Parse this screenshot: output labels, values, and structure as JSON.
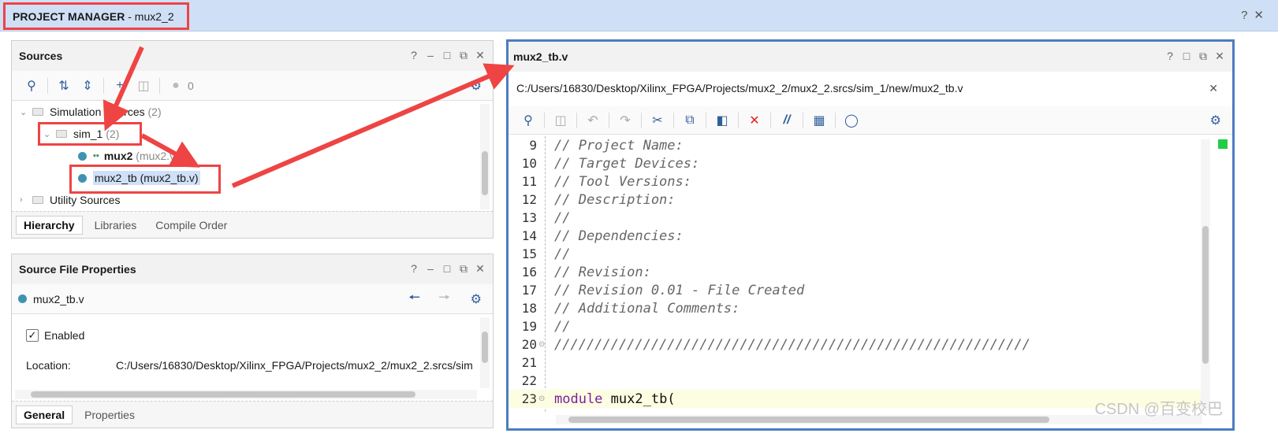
{
  "top_bar": {
    "title_bold": "PROJECT MANAGER",
    "title_rest": " - mux2_2",
    "help": "?",
    "close": "✕"
  },
  "sources": {
    "title": "Sources",
    "status_count": "0",
    "tree": [
      {
        "label": "Simulation Sources",
        "count": "(2)"
      },
      {
        "label": "sim_1",
        "count": "(2)"
      },
      {
        "label": "mux2",
        "suffix": "(mux2.v)"
      },
      {
        "label": "mux2_tb (mux2_tb.v)"
      },
      {
        "label": "Utility Sources"
      }
    ],
    "tabs": [
      "Hierarchy",
      "Libraries",
      "Compile Order"
    ]
  },
  "props": {
    "title": "Source File Properties",
    "file": "mux2_tb.v",
    "enabled_label": "Enabled",
    "location_label": "Location:",
    "location_value": "C:/Users/16830/Desktop/Xilinx_FPGA/Projects/mux2_2/mux2_2.srcs/sim",
    "tabs": [
      "General",
      "Properties"
    ]
  },
  "editor": {
    "title": "mux2_tb.v",
    "path": "C:/Users/16830/Desktop/Xilinx_FPGA/Projects/mux2_2/mux2_2.srcs/sim_1/new/mux2_tb.v",
    "lines": [
      {
        "n": "9",
        "text": "// Project Name:"
      },
      {
        "n": "10",
        "text": "// Target Devices:"
      },
      {
        "n": "11",
        "text": "// Tool Versions:"
      },
      {
        "n": "12",
        "text": "// Description:"
      },
      {
        "n": "13",
        "text": "//"
      },
      {
        "n": "14",
        "text": "// Dependencies:"
      },
      {
        "n": "15",
        "text": "//"
      },
      {
        "n": "16",
        "text": "// Revision:"
      },
      {
        "n": "17",
        "text": "// Revision 0.01 - File Created"
      },
      {
        "n": "18",
        "text": "// Additional Comments:"
      },
      {
        "n": "19",
        "text": "//"
      },
      {
        "n": "20",
        "text": "///////////////////////////////////////////////////////////"
      },
      {
        "n": "21",
        "text": ""
      },
      {
        "n": "22",
        "text": ""
      },
      {
        "n": "23",
        "keyword": "module",
        "text": " mux2_tb("
      }
    ]
  },
  "watermark": "CSDN @百变校巴",
  "colors": {
    "accent": "#4d7cc1",
    "annotation": "#ee4444",
    "header_bg": "#cfdff6"
  }
}
